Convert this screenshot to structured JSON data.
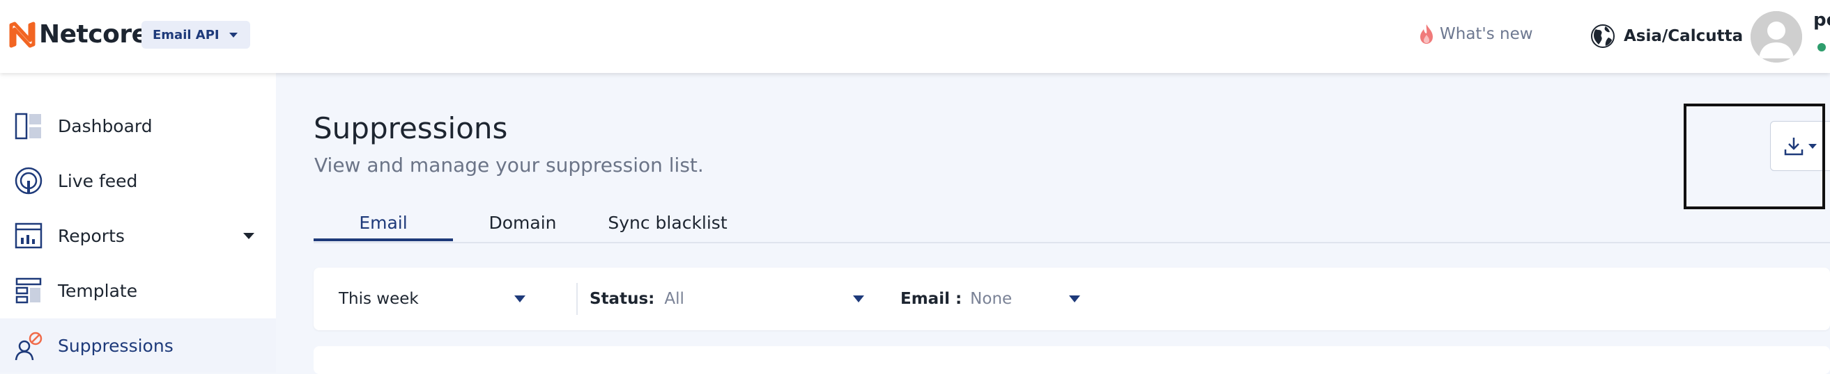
{
  "header": {
    "brand": "Netcore",
    "product_selector": "Email API",
    "whats_new": "What's new",
    "timezone": "Asia/Calcutta",
    "user_initials": "pe"
  },
  "sidebar": {
    "items": [
      {
        "label": "Dashboard",
        "icon": "dashboard-icon",
        "active": false
      },
      {
        "label": "Live feed",
        "icon": "live-feed-icon",
        "active": false
      },
      {
        "label": "Reports",
        "icon": "reports-icon",
        "active": false,
        "expandable": true
      },
      {
        "label": "Template",
        "icon": "template-icon",
        "active": false
      },
      {
        "label": "Suppressions",
        "icon": "suppressions-icon",
        "active": true
      }
    ]
  },
  "page": {
    "title": "Suppressions",
    "subtitle": "View and manage your suppression list."
  },
  "tabs": [
    {
      "label": "Email",
      "active": true
    },
    {
      "label": "Domain",
      "active": false
    },
    {
      "label": "Sync blacklist",
      "active": false
    }
  ],
  "filters": {
    "date_range": "This week",
    "status_label": "Status:",
    "status_value": "All",
    "email_label": "Email :",
    "email_value": "None"
  },
  "toolbar": {
    "download_icon": "download-icon"
  },
  "colors": {
    "brand_orange": "#f26522",
    "accent_navy": "#1e3a7a",
    "online_green": "#2e9d6c",
    "page_background": "#f3f6fc"
  }
}
